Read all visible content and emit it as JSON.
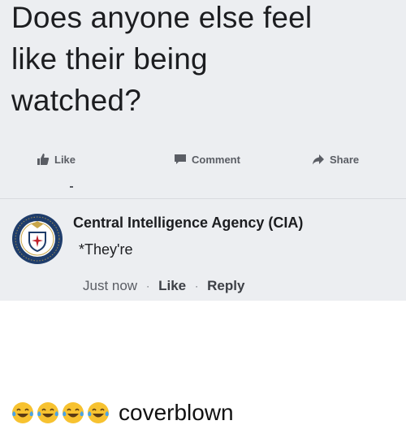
{
  "post": {
    "text": "Does anyone else feel\nlike their being\nwatched?"
  },
  "actions": {
    "like_label": "Like",
    "comment_label": "Comment",
    "share_label": "Share"
  },
  "comment": {
    "author": "Central Intelligence Agency (CIA)",
    "text": "*They're",
    "timestamp": "Just now",
    "separator": "·",
    "like_label": "Like",
    "reply_label": "Reply"
  },
  "caption": {
    "emojis": [
      "face-with-tears-of-joy-icon",
      "face-with-tears-of-joy-icon",
      "face-with-tears-of-joy-icon",
      "face-with-tears-of-joy-icon"
    ],
    "text": "coverblown"
  },
  "colors": {
    "post_background": "#eceef1",
    "text_primary": "#1c1d20",
    "text_secondary": "#5a5d64"
  }
}
